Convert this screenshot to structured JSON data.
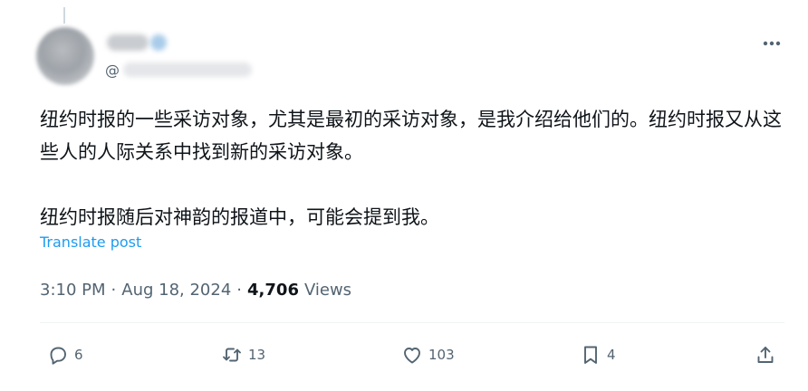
{
  "tweet": {
    "handle_prefix": "@",
    "text": [
      "纽约时报的一些采访对象，尤其是最初的采访对象，是我介绍给他们的。纽约时报又从这些人的人际关系中找到新的采访对象。",
      "纽约时报随后对神韵的报道中，可能会提到我。"
    ],
    "translate_label": "Translate post",
    "time": "3:10 PM",
    "date": "Aug 18, 2024",
    "separator": "·",
    "views_count": "4,706",
    "views_label": "Views"
  },
  "actions": {
    "replies": "6",
    "reposts": "13",
    "likes": "103",
    "bookmarks": "4"
  },
  "icons": {
    "reply": "speech-bubble-icon",
    "repost": "repost-arrows-icon",
    "like": "heart-icon",
    "bookmark": "bookmark-icon",
    "share": "share-upload-icon",
    "more": "ellipsis-icon"
  },
  "colors": {
    "text": "#0f1419",
    "secondary": "#536471",
    "link": "#1d9bf0",
    "divider": "#eff3f4"
  }
}
